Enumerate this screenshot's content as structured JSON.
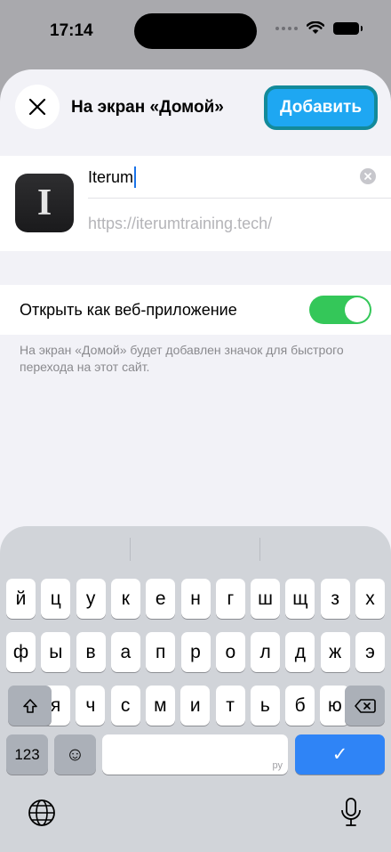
{
  "status_bar": {
    "time": "17:14"
  },
  "nav": {
    "title": "На экран «Домой»",
    "add_label": "Добавить",
    "close_icon": "close-icon"
  },
  "app": {
    "icon_letter": "I",
    "name": "Iterum",
    "url": "https://iterumtraining.tech/"
  },
  "web_app": {
    "label": "Открыть как веб-приложение",
    "enabled": true
  },
  "footnote": "На экран «Домой» будет добавлен значок для быстрого перехода на этот сайт.",
  "keyboard": {
    "row1": [
      "й",
      "ц",
      "у",
      "к",
      "е",
      "н",
      "г",
      "ш",
      "щ",
      "з",
      "х"
    ],
    "row2": [
      "ф",
      "ы",
      "в",
      "а",
      "п",
      "р",
      "о",
      "л",
      "д",
      "ж",
      "э"
    ],
    "row3": [
      "я",
      "ч",
      "с",
      "м",
      "и",
      "т",
      "ь",
      "б",
      "ю"
    ],
    "numbers_key": "123",
    "emoji_key": "☺",
    "space_lang": "ру",
    "return_key": "✓",
    "shift_icon": "shift-icon",
    "delete_icon": "delete-icon",
    "globe_icon": "globe-icon",
    "mic_icon": "microphone-icon"
  },
  "colors": {
    "accent": "#1ea7f2",
    "toggle_on": "#34c759",
    "return_key": "#2f84f6"
  }
}
